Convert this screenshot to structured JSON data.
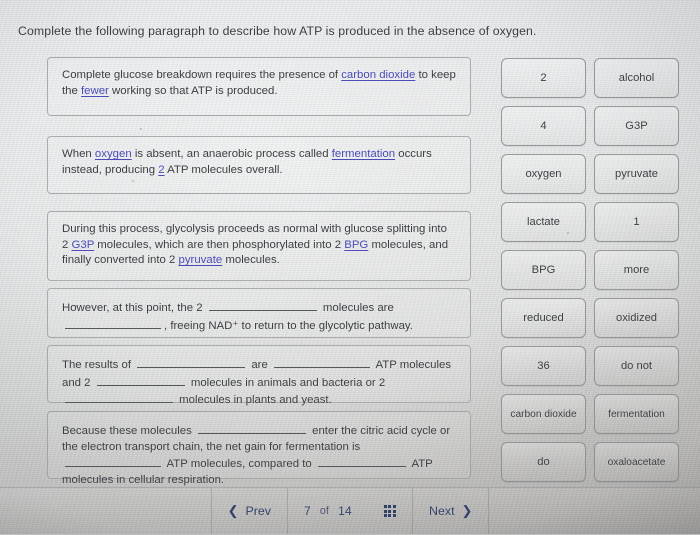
{
  "prompt": "Complete the following paragraph to describe how ATP is produced in the absence of oxygen.",
  "paragraphs": [
    {
      "id": "p1",
      "segments": [
        {
          "t": "text",
          "v": "Complete glucose breakdown requires the presence of "
        },
        {
          "t": "answer",
          "v": "carbon dioxide"
        },
        {
          "t": "text",
          "v": " to keep the "
        },
        {
          "t": "answer",
          "v": "fewer"
        },
        {
          "t": "text",
          "v": " working so that ATP is produced."
        }
      ]
    },
    {
      "id": "p2",
      "segments": [
        {
          "t": "text",
          "v": "When "
        },
        {
          "t": "answer",
          "v": "oxygen"
        },
        {
          "t": "text",
          "v": " is absent, an anaerobic process called "
        },
        {
          "t": "answer",
          "v": "fermentation"
        },
        {
          "t": "text",
          "v": " occurs instead, producing "
        },
        {
          "t": "answer",
          "v": "2"
        },
        {
          "t": "text",
          "v": " ATP molecules overall."
        }
      ]
    },
    {
      "id": "p3",
      "segments": [
        {
          "t": "text",
          "v": "During this process, glycolysis proceeds as normal with glucose splitting into 2 "
        },
        {
          "t": "answer",
          "v": "G3P"
        },
        {
          "t": "text",
          "v": " molecules, which are then phosphorylated into 2 "
        },
        {
          "t": "answer",
          "v": "BPG"
        },
        {
          "t": "text",
          "v": " molecules, and finally converted into 2 "
        },
        {
          "t": "answer",
          "v": "pyruvate"
        },
        {
          "t": "text",
          "v": " molecules."
        }
      ]
    },
    {
      "id": "p4",
      "segments": [
        {
          "t": "text",
          "v": "However, at this point, the 2 "
        },
        {
          "t": "blank",
          "v": ""
        },
        {
          "t": "text",
          "v": " molecules are "
        },
        {
          "t": "blank",
          "v": ""
        },
        {
          "t": "text",
          "v": ", freeing NAD⁺ to return to the glycolytic pathway."
        }
      ]
    },
    {
      "id": "p5",
      "segments": [
        {
          "t": "text",
          "v": "The results of "
        },
        {
          "t": "blank",
          "v": ""
        },
        {
          "t": "text",
          "v": " are "
        },
        {
          "t": "blank",
          "v": ""
        },
        {
          "t": "text",
          "v": " ATP molecules and 2 "
        },
        {
          "t": "blank",
          "v": ""
        },
        {
          "t": "text",
          "v": " molecules in animals and bacteria or 2 "
        },
        {
          "t": "blank",
          "v": ""
        },
        {
          "t": "text",
          "v": " molecules in plants and yeast."
        }
      ]
    },
    {
      "id": "p6",
      "segments": [
        {
          "t": "text",
          "v": "Because these molecules "
        },
        {
          "t": "blank",
          "v": ""
        },
        {
          "t": "text",
          "v": " enter the citric acid cycle or the electron transport chain, the net gain for fermentation is "
        },
        {
          "t": "blank",
          "v": ""
        },
        {
          "t": "text",
          "v": " ATP molecules, compared to "
        },
        {
          "t": "blank",
          "v": ""
        },
        {
          "t": "text",
          "v": " ATP molecules in cellular respiration."
        }
      ]
    }
  ],
  "answer_bank": {
    "rows": [
      [
        "2",
        "alcohol"
      ],
      [
        "4",
        "G3P"
      ],
      [
        "oxygen",
        "pyruvate"
      ],
      [
        "lactate",
        "1"
      ],
      [
        "BPG",
        "more"
      ],
      [
        "reduced",
        "oxidized"
      ],
      [
        "36",
        "do not"
      ],
      [
        "carbon dioxide",
        "fermentation"
      ],
      [
        "do",
        "oxaloacetate"
      ]
    ]
  },
  "nav": {
    "prev_label": "Prev",
    "prev_icon": "chevron-left-icon",
    "next_label": "Next",
    "next_icon": "chevron-right-icon",
    "page_current": "7",
    "page_of": "of",
    "page_total": "14",
    "grid_icon": "grid-menu-icon"
  },
  "colors": {
    "answer_link": "#4a4ab8",
    "body_text": "#3b3e41",
    "nav_text": "#30416b",
    "box_border": "#a9abad",
    "tile_border": "#96989a"
  }
}
